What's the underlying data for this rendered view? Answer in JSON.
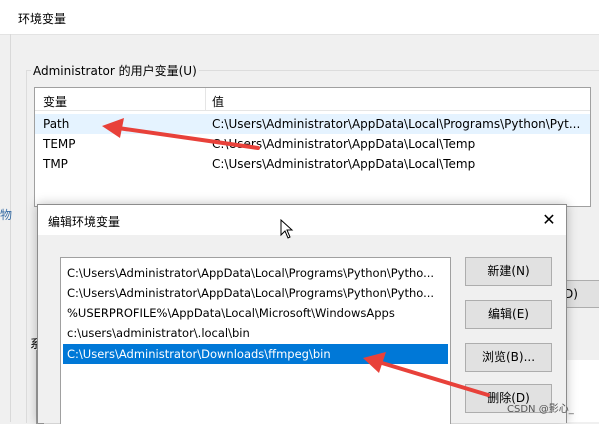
{
  "window": {
    "title": "环境变量",
    "left_fragment": "物"
  },
  "user_vars": {
    "group_label": "Administrator 的用户变量(U)",
    "columns": {
      "name": "变量",
      "value": "值"
    },
    "rows": [
      {
        "name": "Path",
        "value": "C:\\Users\\Administrator\\AppData\\Local\\Programs\\Python\\Pyt..."
      },
      {
        "name": "TEMP",
        "value": "C:\\Users\\Administrator\\AppData\\Local\\Temp"
      },
      {
        "name": "TMP",
        "value": "C:\\Users\\Administrator\\AppData\\Local\\Temp"
      }
    ],
    "partial_button_label": "D)"
  },
  "system_vars": {
    "group_label_fragment": "系"
  },
  "edit_dialog": {
    "title": "编辑环境变量",
    "close_glyph": "✕",
    "paths": [
      {
        "value": "C:\\Users\\Administrator\\AppData\\Local\\Programs\\Python\\Pytho...",
        "selected": false
      },
      {
        "value": "C:\\Users\\Administrator\\AppData\\Local\\Programs\\Python\\Pytho...",
        "selected": false
      },
      {
        "value": "%USERPROFILE%\\AppData\\Local\\Microsoft\\WindowsApps",
        "selected": false
      },
      {
        "value": "c:\\users\\administrator\\.local\\bin",
        "selected": false
      },
      {
        "value": "C:\\Users\\Administrator\\Downloads\\ffmpeg\\bin",
        "selected": true
      }
    ],
    "buttons": {
      "new": "新建(N)",
      "edit": "编辑(E)",
      "browse": "浏览(B)...",
      "delete": "删除(D)"
    }
  },
  "annotations": {
    "arrow_color": "#e8413a"
  },
  "watermark": "CSDN @影心_",
  "colors": {
    "selection_blue": "#0078d7",
    "row_hover": "#e5f3ff"
  }
}
